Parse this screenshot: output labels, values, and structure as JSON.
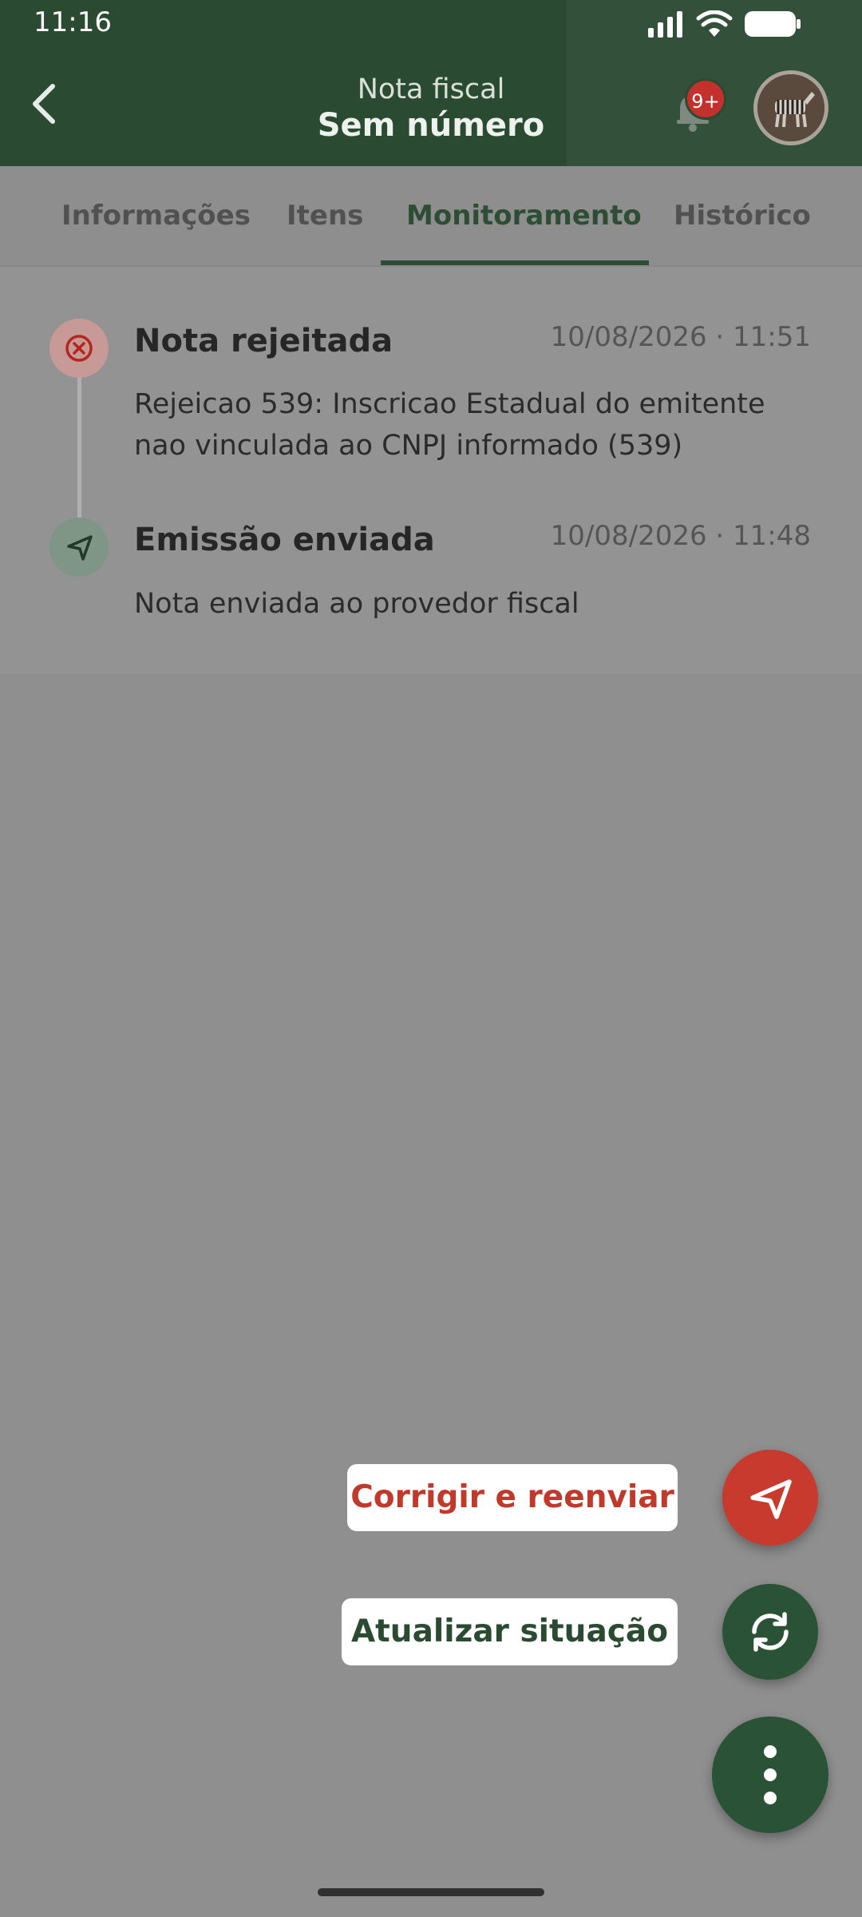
{
  "status_bar": {
    "time": "11:16"
  },
  "header": {
    "subtitle": "Nota fiscal",
    "title": "Sem número",
    "notification_badge": "9+"
  },
  "tabs": [
    {
      "label": "Informações",
      "active": false
    },
    {
      "label": "Itens",
      "active": false
    },
    {
      "label": "Monitoramento",
      "active": true
    },
    {
      "label": "Histórico",
      "active": false
    }
  ],
  "events": [
    {
      "title": "Nota rejeitada",
      "date": "10/08/2026 · 11:51",
      "description": "Rejeicao 539: Inscricao Estadual do emitente nao vinculada ao CNPJ informado (539)",
      "icon": "error-circle-icon"
    },
    {
      "title": "Emissão enviada",
      "date": "10/08/2026 · 11:48",
      "description": "Nota enviada ao provedor fiscal",
      "icon": "send-icon"
    }
  ],
  "actions": {
    "resend_label": "Corrigir e reenviar",
    "refresh_label": "Atualizar situação"
  },
  "colors": {
    "primary": "#2a4a32",
    "danger": "#c83a2e",
    "scrim": "#8f8f8f"
  }
}
